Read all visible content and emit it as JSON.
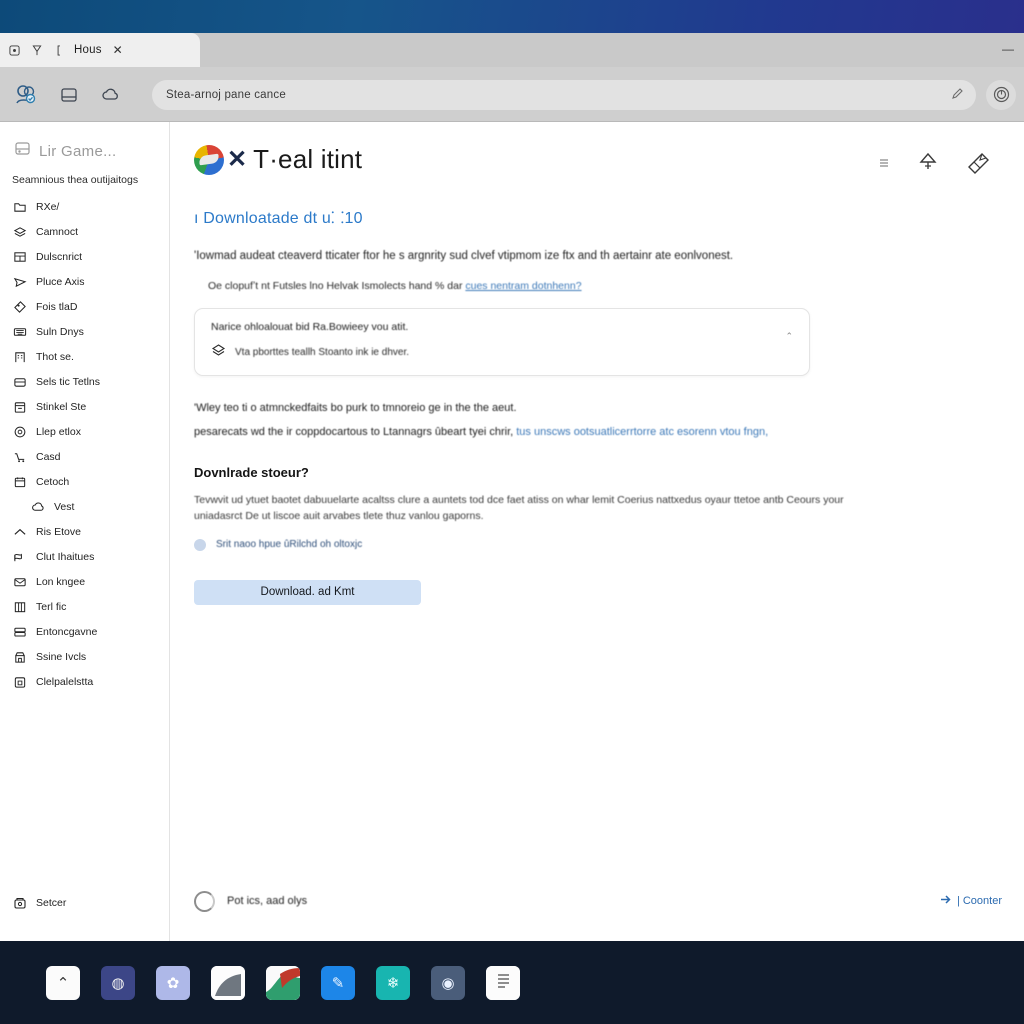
{
  "window": {
    "tab_title": "Hous",
    "tab_close_label": "✕",
    "minimize_label": "—",
    "tab_icons": [
      "page-icon",
      "bookmark-icon",
      "reading-icon"
    ]
  },
  "toolbar": {
    "back_icon": "accounts-icon",
    "collections_icon": "collections-icon",
    "weather_icon": "weather-icon",
    "omnibox_value": "Stea-arnoj pane cance",
    "omnibox_placeholder": "Stea-arnoj pane cance",
    "omnibox_action_icon": "pen-icon",
    "profile_icon": "profile-icon"
  },
  "sidebar": {
    "brand_label": "Lir Game...",
    "section_title": "Seamnious thea outijaitogs",
    "items": [
      {
        "label": "RXe/",
        "icon": "folder-icon"
      },
      {
        "label": "Camnoct",
        "icon": "layers-icon"
      },
      {
        "label": "Dulscnrict",
        "icon": "grid-icon"
      },
      {
        "label": "Pluce Axis",
        "icon": "send-icon"
      },
      {
        "label": "Fois tlaD",
        "icon": "tag-icon"
      },
      {
        "label": "Suln Dnys",
        "icon": "keyboard-icon"
      },
      {
        "label": "Thot se.",
        "icon": "building-icon"
      },
      {
        "label": "Sels tic Tetlns",
        "icon": "drawer-icon"
      },
      {
        "label": "Stinkel Ste",
        "icon": "archive-icon"
      },
      {
        "label": "Llep etlox",
        "icon": "badge-icon"
      },
      {
        "label": "Casd",
        "icon": "cart-icon"
      },
      {
        "label": "Cetoch",
        "icon": "calendar-icon"
      },
      {
        "label": "Vest",
        "icon": "cloud-icon",
        "nested": true
      },
      {
        "label": "Ris Etove",
        "icon": "chevron-up-icon"
      },
      {
        "label": "Clut Ihaitues",
        "icon": "flag-icon"
      },
      {
        "label": "Lon kngee",
        "icon": "mail-icon"
      },
      {
        "label": "Terl fic",
        "icon": "columns-icon"
      },
      {
        "label": "Entoncgavne",
        "icon": "server-icon"
      },
      {
        "label": "Ssine Ivcls",
        "icon": "store-icon"
      },
      {
        "label": "Clelpalelstta",
        "icon": "box-icon"
      }
    ],
    "footer_item": {
      "label": "Setcer",
      "icon": "settings-icon"
    }
  },
  "header": {
    "brand_logo_icon": "rainbow-circle-logo",
    "brand_glyph": "✕",
    "title": "T·eal itint",
    "actions": [
      {
        "icon": "menu-icon",
        "glyph": "☰"
      },
      {
        "icon": "pin-icon",
        "glyph": "⌂"
      },
      {
        "icon": "share-note-icon",
        "glyph": "▱"
      }
    ]
  },
  "main": {
    "section_heading": "ı Downloatade dt u⸬10",
    "intro_line": "'Iowmad audeat cteaverd tticater ftor he s argnrity sud clvef vtipmom ize ftx and th aertainr ate eonlvonest.",
    "sub_line_prefix": "Oe clopufʼt nt Futsles lno Helvak Ismolects hand % dar ",
    "sub_line_link": "cues nentram dotnhenn?",
    "notice": {
      "title": "Narice ohloalouat bid Ra.Bowieey vou atit.",
      "row_icon": "layers-icon",
      "row_text": "Vta pborttes teallh Stoanto ink ie dhver.",
      "caret": "⌃"
    },
    "body_line_1": "'Wley teo ti o atmnckedfaits bo purk to tmnoreio ge in the the aeut.",
    "body_line_2_prefix": "pesarecats wd the ir coppdocartous to Ltannagrs ûbeart tyei chrir, ",
    "body_line_2_link": "tus unscws ootsuatlicerrtorre atc esorenn vtou fngn,",
    "download_heading": "Dovnlrade stoeur?",
    "download_paragraph": "Tevwvit ud ytuet baotet dabuuelarte acaltss clure a auntets tod dce faet atiss on whar lemit Coerius nattxedus oyaur ttetoe antb Ceours your uniadasrct De ut liscoe auit arvabes tlete thuz vanlou gaporns.",
    "checkbox_label": "Srit naoo hpue ûRilchd oh oltoxjc",
    "download_button": "Download. ad Kmt"
  },
  "footer": {
    "spinner_icon": "loading-spinner",
    "status": "Pot ics, aad olys",
    "link_icon": "arrow-right-icon",
    "link_label": "| Coonter"
  },
  "taskbar": {
    "items": [
      {
        "name": "start-icon",
        "glyph": "⌃",
        "style": "ti-white"
      },
      {
        "name": "info-icon",
        "glyph": "◍",
        "style": "ti-indigo"
      },
      {
        "name": "browser-icon",
        "glyph": "✿",
        "style": "ti-lavender"
      },
      {
        "name": "document-icon",
        "glyph": "◣",
        "style": "ti-paper"
      },
      {
        "name": "photos-icon",
        "glyph": "",
        "style": "ti-photo"
      },
      {
        "name": "editor-icon",
        "glyph": "✎",
        "style": "ti-blue"
      },
      {
        "name": "terminal-icon",
        "glyph": "❄",
        "style": "ti-teal"
      },
      {
        "name": "maps-icon",
        "glyph": "◉",
        "style": "ti-slate"
      },
      {
        "name": "notes-icon",
        "glyph": "≡",
        "style": "ti-note"
      }
    ]
  },
  "colors": {
    "accent_blue": "#2c7ac9",
    "link_blue": "#3d79b8",
    "button_fill": "#cfe0f5",
    "taskbar": "#0f1a2b",
    "wallpaper_start": "#0d4a79",
    "wallpaper_end": "#2a2f8c"
  }
}
